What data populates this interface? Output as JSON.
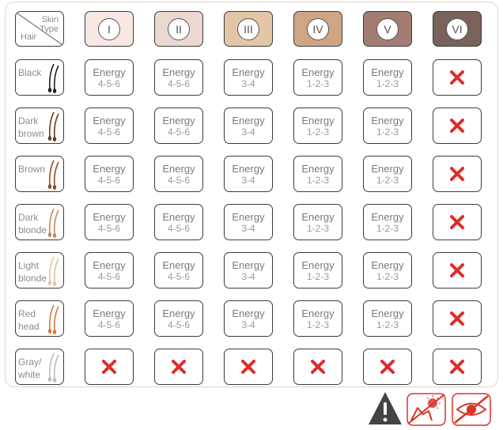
{
  "corner": {
    "skin": "Skin",
    "type": "Type",
    "hair": "Hair"
  },
  "skin_types": [
    {
      "numeral": "I",
      "color": "#f9e7e3"
    },
    {
      "numeral": "II",
      "color": "#ecd8d1"
    },
    {
      "numeral": "III",
      "color": "#e2c6a5"
    },
    {
      "numeral": "IV",
      "color": "#cfa584"
    },
    {
      "numeral": "V",
      "color": "#a37d74"
    },
    {
      "numeral": "VI",
      "color": "#78625b"
    }
  ],
  "hair_rows": [
    {
      "label": "Black",
      "hair_color": "#1f1f1f",
      "cells": [
        [
          "Energy",
          "4-5-6"
        ],
        [
          "Energy",
          "4-5-6"
        ],
        [
          "Energy",
          "3-4"
        ],
        [
          "Energy",
          "1-2-3"
        ],
        [
          "Energy",
          "1-2-3"
        ],
        null
      ]
    },
    {
      "label": "Dark brown",
      "hair_color": "#6b3a1c",
      "cells": [
        [
          "Energy",
          "4-5-6"
        ],
        [
          "Energy",
          "4-5-6"
        ],
        [
          "Energy",
          "3-4"
        ],
        [
          "Energy",
          "1-2-3"
        ],
        [
          "Energy",
          "1-2-3"
        ],
        null
      ]
    },
    {
      "label": "Brown",
      "hair_color": "#8a4f28",
      "cells": [
        [
          "Energy",
          "4-5-6"
        ],
        [
          "Energy",
          "4-5-6"
        ],
        [
          "Energy",
          "3-4"
        ],
        [
          "Energy",
          "1-2-3"
        ],
        [
          "Energy",
          "1-2-3"
        ],
        null
      ]
    },
    {
      "label": "Dark blonde",
      "hair_color": "#c08a5b",
      "cells": [
        [
          "Energy",
          "4-5-6"
        ],
        [
          "Energy",
          "4-5-6"
        ],
        [
          "Energy",
          "3-4"
        ],
        [
          "Energy",
          "1-2-3"
        ],
        [
          "Energy",
          "1-2-3"
        ],
        null
      ]
    },
    {
      "label": "Light blonde",
      "hair_color": "#e3c29c",
      "cells": [
        [
          "Energy",
          "4-5-6"
        ],
        [
          "Energy",
          "4-5-6"
        ],
        [
          "Energy",
          "3-4"
        ],
        [
          "Energy",
          "1-2-3"
        ],
        [
          "Energy",
          "1-2-3"
        ],
        null
      ]
    },
    {
      "label": "Red head",
      "hair_color": "#d97a3a",
      "cells": [
        [
          "Energy",
          "4-5-6"
        ],
        [
          "Energy",
          "4-5-6"
        ],
        [
          "Energy",
          "3-4"
        ],
        [
          "Energy",
          "1-2-3"
        ],
        [
          "Energy",
          "1-2-3"
        ],
        null
      ]
    },
    {
      "label": "Gray/ white",
      "hair_color": "#bdbdbd",
      "cells": [
        null,
        null,
        null,
        null,
        null,
        null
      ]
    }
  ],
  "colors": {
    "cross": "#e02b2b",
    "border": "#3c3c3c",
    "label": "#8c8c8c",
    "warning": "#444444"
  },
  "footer_icons": [
    "warning-icon",
    "no-sun-exposure-icon",
    "no-eye-exposure-icon"
  ]
}
